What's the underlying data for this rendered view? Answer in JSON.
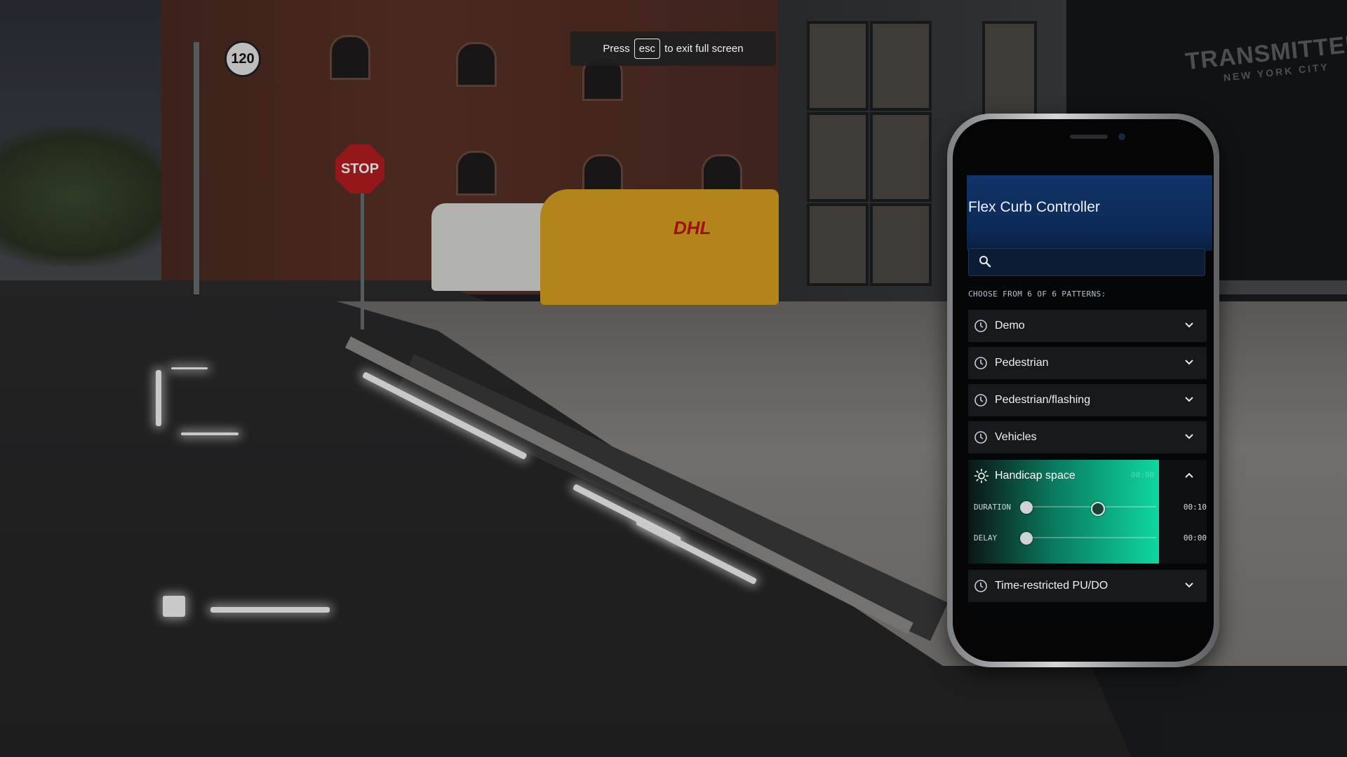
{
  "fullscreen_notice": {
    "press": "Press",
    "key": "esc",
    "suffix": "to exit full screen"
  },
  "scene": {
    "stop_sign": "STOP",
    "speed_sign": "120",
    "truck_brand": "DHL",
    "building_brand": "TRANSMITTER",
    "building_brand_sub": "NEW YORK CITY"
  },
  "app": {
    "title": "Flex Curb Controller",
    "search": {
      "value": "",
      "placeholder": ""
    },
    "choose_label": "CHOOSE FROM 6 OF 6 PATTERNS:",
    "patterns": [
      {
        "label": "Demo",
        "icon": "clock-icon",
        "expanded": false
      },
      {
        "label": "Pedestrian",
        "icon": "clock-icon",
        "expanded": false
      },
      {
        "label": "Pedestrian/flashing",
        "icon": "clock-icon",
        "expanded": false
      },
      {
        "label": "Vehicles",
        "icon": "clock-icon",
        "expanded": false
      },
      {
        "label": "Handicap space",
        "icon": "sun-icon",
        "expanded": true,
        "timer": "00:08",
        "duration_label": "DURATION",
        "duration_value": "00:10",
        "duration_progress": 0.55,
        "delay_label": "DELAY",
        "delay_value": "00:00",
        "delay_progress": 0.0
      },
      {
        "label": "Time-restricted PU/DO",
        "icon": "clock-icon",
        "expanded": false
      }
    ],
    "colors": {
      "header": "#12336a",
      "active_gradient_end": "#0fd7a0",
      "row_bg": "#17191c"
    }
  }
}
